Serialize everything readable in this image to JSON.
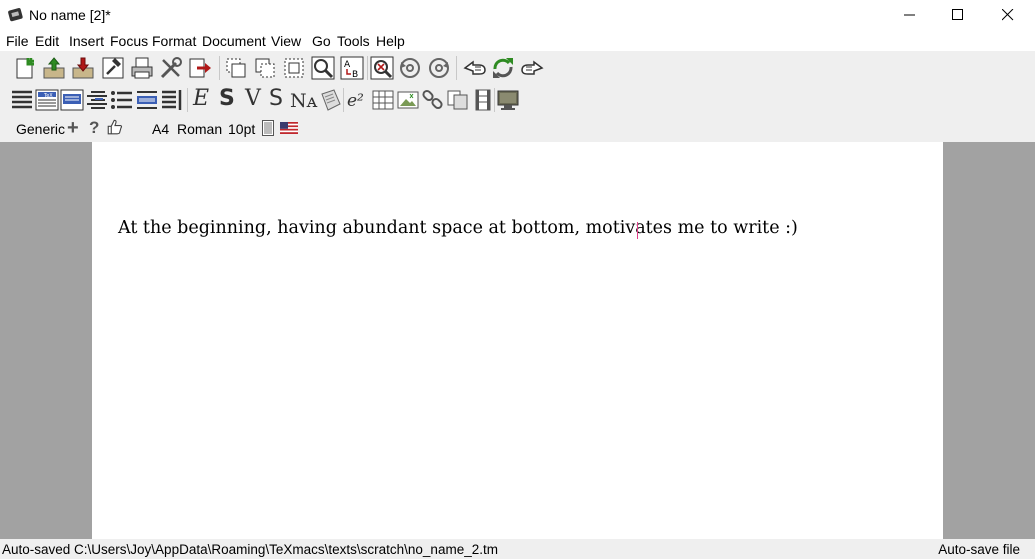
{
  "window": {
    "title": "No name [2]*",
    "icons": {
      "app": "texmacs-app-icon",
      "minimize": "minimize-icon",
      "maximize": "maximize-icon",
      "close": "close-icon"
    }
  },
  "menu": {
    "items": [
      "File",
      "Edit",
      "Insert",
      "Focus",
      "Format",
      "Document",
      "View",
      "Go",
      "Tools",
      "Help"
    ]
  },
  "toolbar": {
    "row1_icons": [
      "new-document-icon",
      "open-document-icon",
      "save-document-icon",
      "typeset-hammer-icon",
      "print-icon",
      "preferences-tools-icon",
      "export-icon",
      "copy-icon",
      "cut-icon",
      "paste-icon",
      "search-icon",
      "replace-icon",
      "spell-check-icon",
      "undo-icon",
      "redo-icon",
      "go-back-icon",
      "reload-icon",
      "go-forward-icon"
    ],
    "row2_icons": [
      "align-left-icon",
      "title-block-icon",
      "section-block-icon",
      "list-align-icon",
      "itemize-icon",
      "table-block-icon",
      "enumerate-icon",
      "emphasize-icon",
      "strong-icon",
      "verbatim-icon",
      "small-caps-icon",
      "name-icon",
      "sample-icon",
      "formula-icon",
      "table-icon",
      "image-icon",
      "link-icon",
      "footnote-icon",
      "animation-icon",
      "session-icon"
    ],
    "row2_glyphs": {
      "emphasize": "E",
      "strong": "S",
      "verbatim": "V",
      "sans": "S",
      "name": "Nᴀ",
      "formula": "e²"
    },
    "focus": {
      "style": "Generic",
      "plus": "+",
      "help": "?",
      "paper": "A4",
      "font": "Roman",
      "size": "10pt",
      "icons": [
        "add-icon",
        "help-icon",
        "thumbs-up-icon",
        "page-setup-icon",
        "us-flag-icon"
      ]
    }
  },
  "document": {
    "text": "At the beginning, having abundant space at bottom, motivates me to write :)"
  },
  "status": {
    "left": "Auto-saved C:\\Users\\Joy\\AppData\\Roaming\\TeXmacs\\texts\\scratch\\no_name_2.tm",
    "right": "Auto-save file"
  },
  "colors": {
    "toolbar_bg": "#efefef",
    "margin_gray": "#a2a2a2",
    "page_bg": "#ffffff",
    "icon_green": "#2e8b22",
    "icon_red": "#b01818",
    "cursor": "#e0408a"
  }
}
